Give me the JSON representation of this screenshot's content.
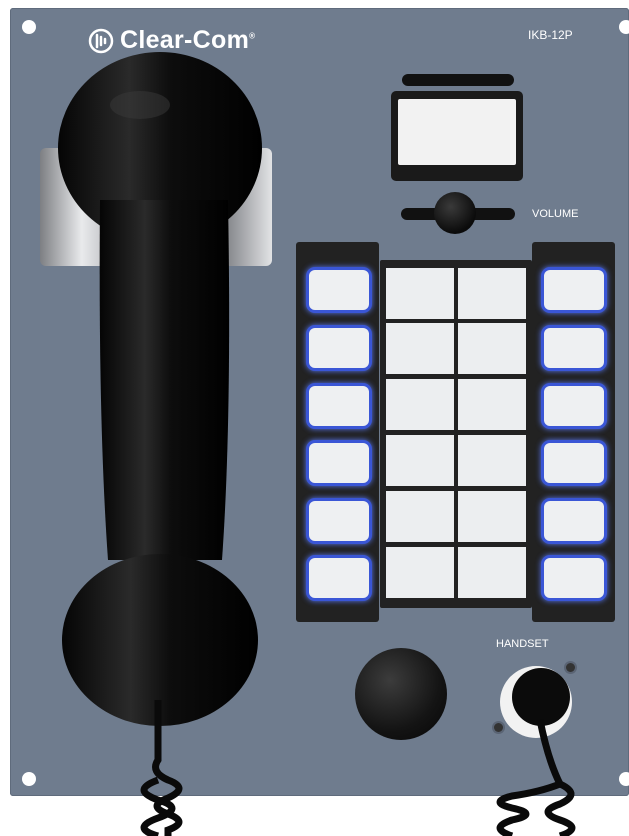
{
  "panel": {
    "brand": "Clear-Com",
    "brand_mark": "®",
    "model": "IKB-12P",
    "volume_label": "VOLUME",
    "handset_label": "HANDSET"
  },
  "colors": {
    "panel": "#6f7c8e",
    "key_backlight": "#3a56d6",
    "key_face": "#eef0f2",
    "handset": "#0b0b0b"
  },
  "icons": [
    "clear-com-logo-icon",
    "handset-icon",
    "coiled-cord-icon"
  ]
}
